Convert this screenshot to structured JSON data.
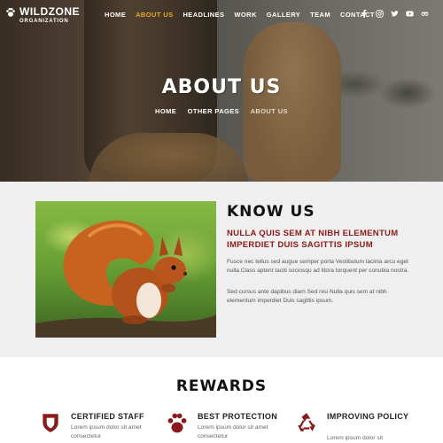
{
  "brand": {
    "title": "WILDZONE",
    "subtitle": "ORGANIZATION"
  },
  "nav": {
    "items": [
      {
        "label": "HOME",
        "active": false
      },
      {
        "label": "ABOUT US",
        "active": true
      },
      {
        "label": "HEADLINES",
        "active": false
      },
      {
        "label": "WORK",
        "active": false
      },
      {
        "label": "GALLERY",
        "active": false
      },
      {
        "label": "TEAM",
        "active": false
      },
      {
        "label": "CONTACT",
        "active": false
      }
    ],
    "social": [
      "facebook-icon",
      "instagram-icon",
      "twitter-icon",
      "youtube-icon",
      "tripadvisor-icon"
    ]
  },
  "hero": {
    "title": "ABOUT US",
    "breadcrumb": [
      "HOME",
      "OTHER PAGES",
      "ABOUT US"
    ]
  },
  "about": {
    "title": "KNOW US",
    "subtitle": "NULLA QUIS SEM AT NIBH ELEMENTUM IMPERDIET DUIS SAGITTIS IPSUM",
    "paragraph1": "Fusce nec tellus sed augue semper porta Vestibulum lacinia arcu eget nulla.Class aptent taciti sociosqu ad litora torquent per conubia nostra.",
    "paragraph2": "Sed cursus ante dapibus diam Sed nisi Nulla quis sem at nibh elementum imperdiet Duis sagittis ipsum."
  },
  "rewards": {
    "title": "REWARDS",
    "items": [
      {
        "title": "CERTIFIED STAFF",
        "desc": "Lorem ipsum dolor sit amet consectetur",
        "icon": "shield-icon"
      },
      {
        "title": "BEST PROTECTION",
        "desc": "Lorem ipsum dolor sit amet consectetur",
        "icon": "paw-icon"
      },
      {
        "title": "IMPROVING POLICY",
        "desc": "Lorem ipsum dolor sit",
        "icon": "recycle-icon"
      }
    ]
  },
  "colors": {
    "accent": "#e8a928",
    "brand_red": "#8b1a1a",
    "section_bg": "#efefef"
  }
}
